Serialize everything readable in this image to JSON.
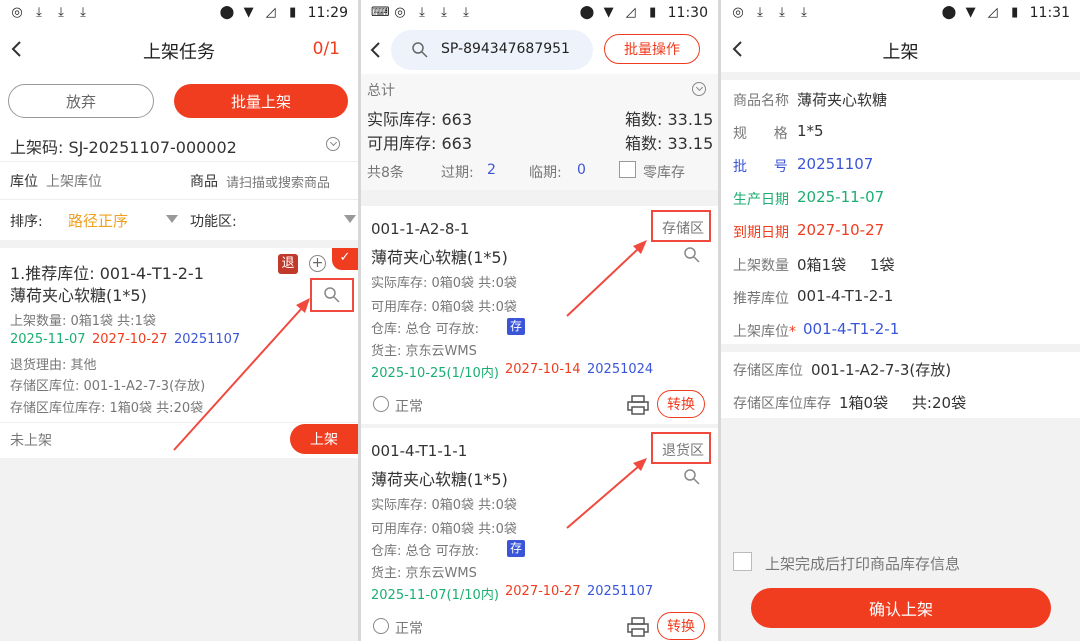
{
  "screen1": {
    "time": "11:29",
    "title": "上架任务",
    "count": "0/1",
    "btn_abandon": "放弃",
    "btn_batch": "批量上架",
    "code_label": "上架码: SJ-20251107-000002",
    "loc_label": "库位",
    "loc_placeholder": "上架库位",
    "goods_label": "商品",
    "goods_placeholder": "请扫描或搜索商品",
    "sort_label": "排序:",
    "sort_value": "路径正序",
    "func_label": "功能区:",
    "card": {
      "rec": "1.推荐库位:  001-4-T1-2-1",
      "name": "薄荷夹心软糖(1*5)",
      "badge": "退",
      "qty": "上架数量: 0箱1袋    共:1袋",
      "date1": "2025-11-07",
      "date2": "2027-10-27",
      "batch": "20251107",
      "reason": "退货理由: 其他",
      "store_loc": "存储区库位:  001-1-A2-7-3(存放)",
      "store_stock": "存储区库位库存:  1箱0袋    共:20袋",
      "status": "未上架",
      "btn": "上架"
    }
  },
  "screen2": {
    "time": "11:30",
    "search_value": "SP-894347687951",
    "btn_batch": "批量操作",
    "total": "总计",
    "actual_label": "实际库存: 663",
    "boxes1": "箱数:  33.15",
    "avail_label": "可用库存: 663",
    "boxes2": "箱数:  33.15",
    "count_total": "共8条",
    "expired_label": "过期:",
    "expired_val": "2",
    "near_label": "临期:",
    "near_val": "0",
    "zero_label": "零库存",
    "cards": [
      {
        "loc": "001-1-A2-8-1",
        "zone": "存储区",
        "name": "薄荷夹心软糖(1*5)",
        "actual": "实际库存:  0箱0袋     共:0袋",
        "avail": "可用库存:  0箱0袋     共:0袋",
        "wh": "仓库:  总仓    可存放:",
        "tag": "存",
        "owner": "货主:  京东云WMS",
        "d1": "2025-10-25(1/10内)",
        "d2": "2027-10-14",
        "d3": "20251024",
        "status": "正常",
        "btn": "转换"
      },
      {
        "loc": "001-4-T1-1-1",
        "zone": "退货区",
        "name": "薄荷夹心软糖(1*5)",
        "actual": "实际库存:  0箱0袋     共:0袋",
        "avail": "可用库存:  0箱0袋     共:0袋",
        "wh": "仓库:  总仓    可存放:",
        "tag": "存",
        "owner": "货主:  京东云WMS",
        "d1": "2025-11-07(1/10内)",
        "d2": "2027-10-27",
        "d3": "20251107",
        "status": "正常",
        "btn": "转换"
      }
    ]
  },
  "screen3": {
    "time": "11:31",
    "title": "上架",
    "name_label": "商品名称",
    "name_val": "薄荷夹心软糖",
    "spec_label": "规      格",
    "spec_val": "1*5",
    "batch_label": "批      号",
    "batch_val": "20251107",
    "prod_label": "生产日期",
    "prod_val": "2025-11-07",
    "exp_label": "到期日期",
    "exp_val": "2027-10-27",
    "qty_label": "上架数量",
    "qty_val": "0箱1袋     1袋",
    "rec_label": "推荐库位",
    "rec_val": "001-4-T1-2-1",
    "put_label": "上架库位",
    "put_val": "001-4-T1-2-1",
    "store_label": "存储区库位",
    "store_val": "001-1-A2-7-3(存放)",
    "store_stock_label": "存储区库位库存",
    "store_stock_val": "1箱0袋     共:20袋",
    "print_label": "上架完成后打印商品库存信息",
    "confirm": "确认上架"
  }
}
